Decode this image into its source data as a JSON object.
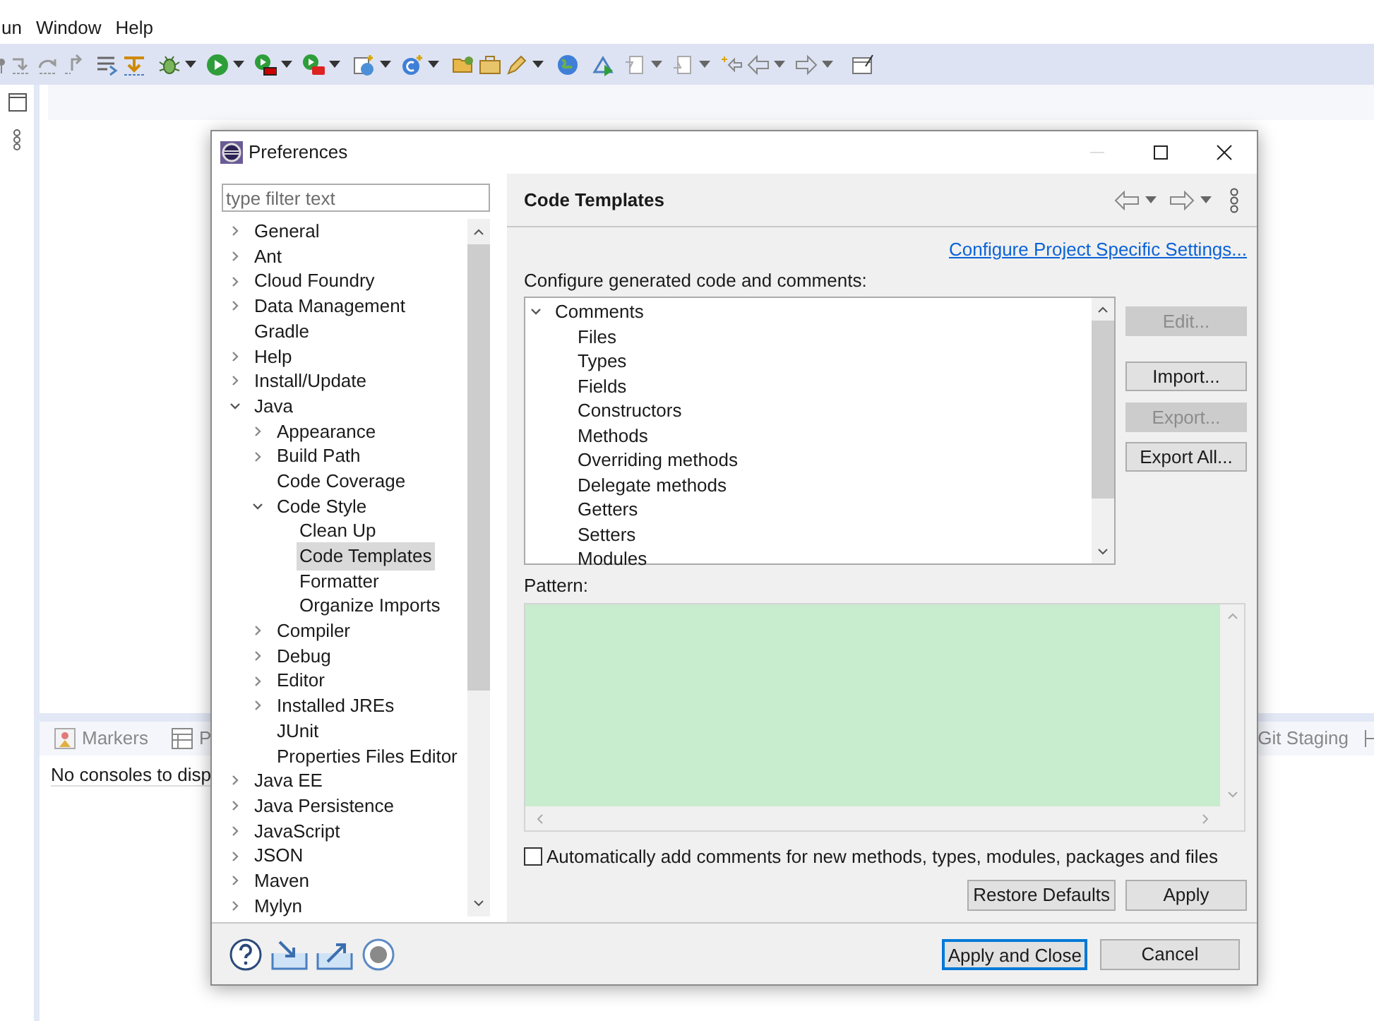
{
  "menu_bar": [
    "un",
    "Window",
    "Help"
  ],
  "bottom_panel": {
    "tabs": [
      {
        "label": "Markers",
        "selected": false
      },
      {
        "label": "P",
        "selected": false
      },
      {
        "label": "Git Staging",
        "selected": false
      }
    ],
    "message": "No consoles to disp"
  },
  "dialog": {
    "title": "Preferences",
    "filter": {
      "placeholder": "type filter text"
    },
    "tree": [
      {
        "label": "General",
        "expanded": false,
        "selected": false
      },
      {
        "label": "Ant",
        "expanded": false,
        "selected": false
      },
      {
        "label": "Cloud Foundry",
        "expanded": false,
        "selected": false
      },
      {
        "label": "Data Management",
        "expanded": false,
        "selected": false
      },
      {
        "label": "Gradle",
        "selected": false
      },
      {
        "label": "Help",
        "expanded": false,
        "selected": false
      },
      {
        "label": "Install/Update",
        "expanded": false,
        "selected": false
      },
      {
        "label": "Java",
        "expanded": true,
        "selected": false,
        "children": [
          {
            "label": "Appearance",
            "expanded": false,
            "selected": false
          },
          {
            "label": "Build Path",
            "expanded": false,
            "selected": false
          },
          {
            "label": "Code Coverage",
            "selected": false
          },
          {
            "label": "Code Style",
            "expanded": true,
            "selected": false,
            "children": [
              {
                "label": "Clean Up",
                "selected": false
              },
              {
                "label": "Code Templates",
                "selected": true
              },
              {
                "label": "Formatter",
                "selected": false
              },
              {
                "label": "Organize Imports",
                "selected": false
              }
            ]
          },
          {
            "label": "Compiler",
            "expanded": false,
            "selected": false
          },
          {
            "label": "Debug",
            "expanded": false,
            "selected": false
          },
          {
            "label": "Editor",
            "expanded": false,
            "selected": false
          },
          {
            "label": "Installed JREs",
            "expanded": false,
            "selected": false
          },
          {
            "label": "JUnit",
            "selected": false
          },
          {
            "label": "Properties Files Editor",
            "selected": false
          }
        ]
      },
      {
        "label": "Java EE",
        "expanded": false,
        "selected": false
      },
      {
        "label": "Java Persistence",
        "expanded": false,
        "selected": false
      },
      {
        "label": "JavaScript",
        "expanded": false,
        "selected": false
      },
      {
        "label": "JSON",
        "expanded": false,
        "selected": false
      },
      {
        "label": "Maven",
        "expanded": false,
        "selected": false
      },
      {
        "label": "Mylyn",
        "expanded": false,
        "selected": false
      }
    ],
    "page": {
      "title": "Code Templates",
      "link": "Configure Project Specific Settings...",
      "label": "Configure generated code and comments:",
      "templates": [
        {
          "label": "Comments",
          "expanded": true,
          "selected": false,
          "children": [
            {
              "label": "Files",
              "selected": false
            },
            {
              "label": "Types",
              "selected": false
            },
            {
              "label": "Fields",
              "selected": false
            },
            {
              "label": "Constructors",
              "selected": false
            },
            {
              "label": "Methods",
              "selected": false
            },
            {
              "label": "Overriding methods",
              "selected": false
            },
            {
              "label": "Delegate methods",
              "selected": false
            },
            {
              "label": "Getters",
              "selected": false
            },
            {
              "label": "Setters",
              "selected": false
            },
            {
              "label": "Modules",
              "selected": false
            }
          ]
        }
      ],
      "side_buttons": [
        {
          "label": "Edit...",
          "disabled": true
        },
        {
          "label": "Import...",
          "disabled": false
        },
        {
          "label": "Export...",
          "disabled": true
        },
        {
          "label": "Export All...",
          "disabled": false
        }
      ],
      "pattern_label": "Pattern:",
      "auto_comments": {
        "label": "Automatically add comments for new methods, types, modules, packages and files",
        "checked": false
      },
      "buttons": [
        {
          "label": "Restore Defaults"
        },
        {
          "label": "Apply"
        }
      ]
    },
    "footer_buttons": [
      {
        "label": "Apply and Close",
        "default": true
      },
      {
        "label": "Cancel",
        "default": false
      }
    ]
  }
}
